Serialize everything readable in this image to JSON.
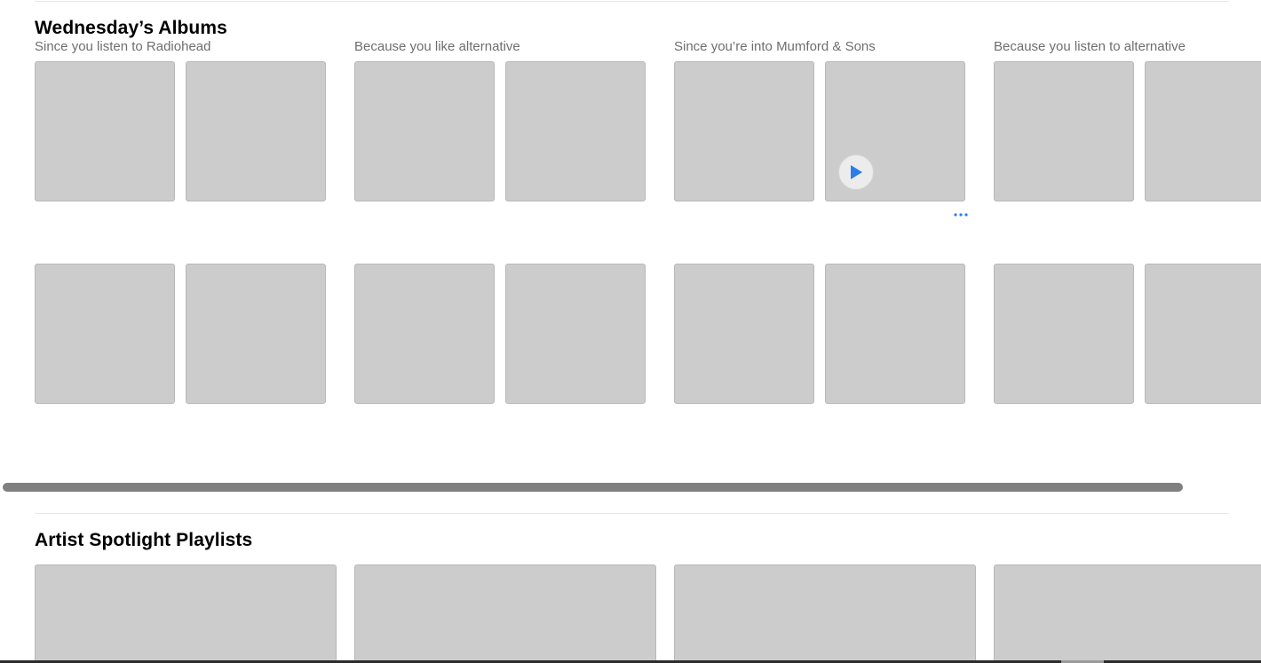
{
  "albums_section": {
    "title": "Wednesday’s Albums",
    "groups": [
      {
        "label": "Since you listen to Radiohead"
      },
      {
        "label": "Because you like alternative"
      },
      {
        "label": "Since you’re into Mumford & Sons"
      },
      {
        "label": "Because you listen to alternative"
      }
    ]
  },
  "playlists_section": {
    "title": "Artist Spotlight Playlists"
  },
  "icons": {
    "play": "play-icon",
    "more": "more-icon"
  },
  "colors": {
    "accent": "#2b7de9",
    "placeholder": "#cccccc",
    "scrollbar": "#808080"
  }
}
